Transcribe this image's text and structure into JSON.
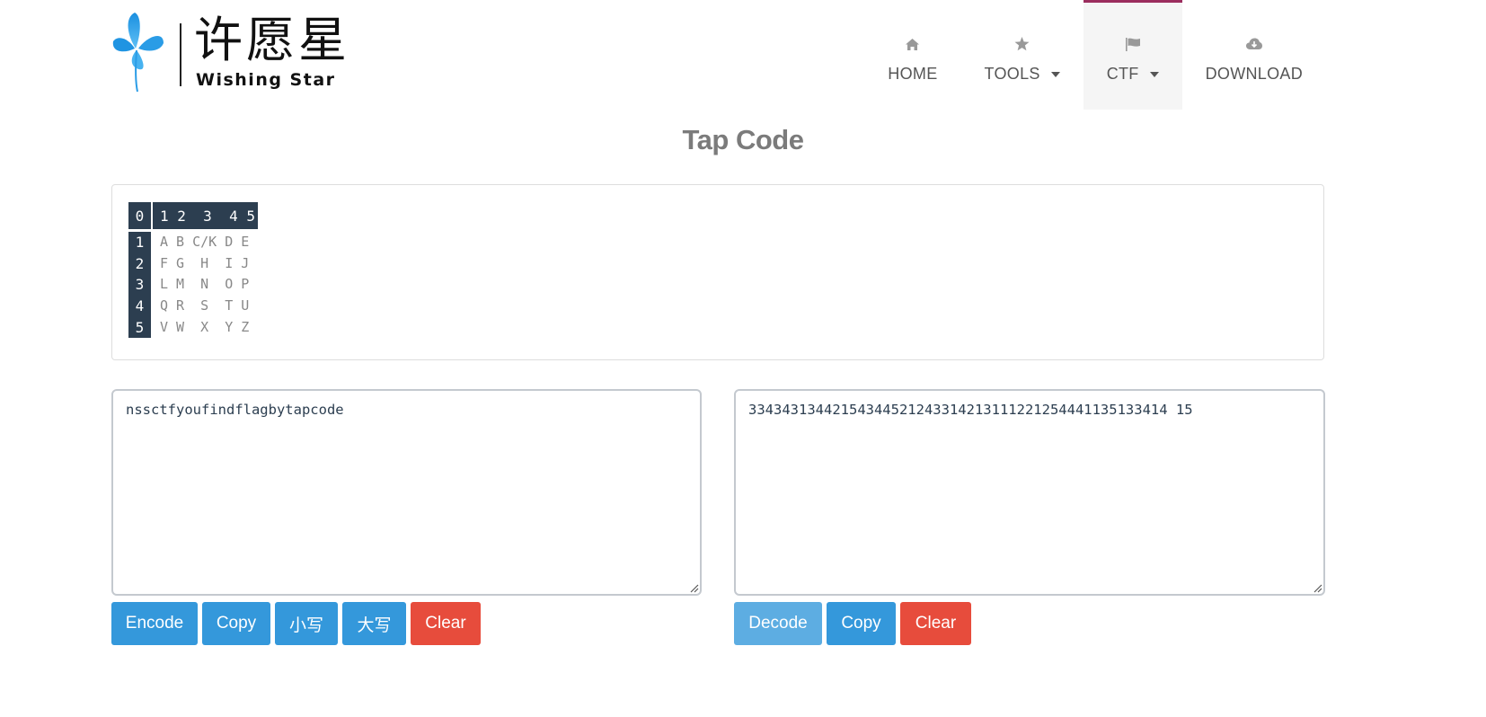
{
  "logo": {
    "chinese": "许愿星",
    "english": "Wishing Star"
  },
  "nav": {
    "items": [
      {
        "label": "HOME",
        "icon": "home-icon",
        "dropdown": false,
        "active": false
      },
      {
        "label": "TOOLS",
        "icon": "star-icon",
        "dropdown": true,
        "active": false
      },
      {
        "label": "CTF",
        "icon": "flag-icon",
        "dropdown": true,
        "active": true
      },
      {
        "label": "DOWNLOAD",
        "icon": "cloud-download-icon",
        "dropdown": false,
        "active": false
      }
    ],
    "active_color": "#9b2d5e"
  },
  "page": {
    "title": "Tap Code"
  },
  "tap_grid": {
    "corner": "0",
    "columns": "1 2  3  4 5",
    "row_numbers": [
      "1",
      "2",
      "3",
      "4",
      "5"
    ],
    "rows": [
      "A B C/K D E",
      "F G  H  I J",
      "L M  N  O P",
      "Q R  S  T U",
      "V W  X  Y Z"
    ]
  },
  "plaintext": {
    "value": "nssctfyoufindflagbytapcode"
  },
  "ciphertext": {
    "value": "33434313442154344521243314213111221254441135133414 15"
  },
  "buttons_left": {
    "encode": "Encode",
    "copy": "Copy",
    "lower": "小写",
    "upper": "大写",
    "clear": "Clear"
  },
  "buttons_right": {
    "decode": "Decode",
    "copy": "Copy",
    "clear": "Clear"
  },
  "colors": {
    "primary": "#3498db",
    "primary_light": "#5dade2",
    "danger": "#e74c3c",
    "grid_header": "#2c3e50"
  }
}
